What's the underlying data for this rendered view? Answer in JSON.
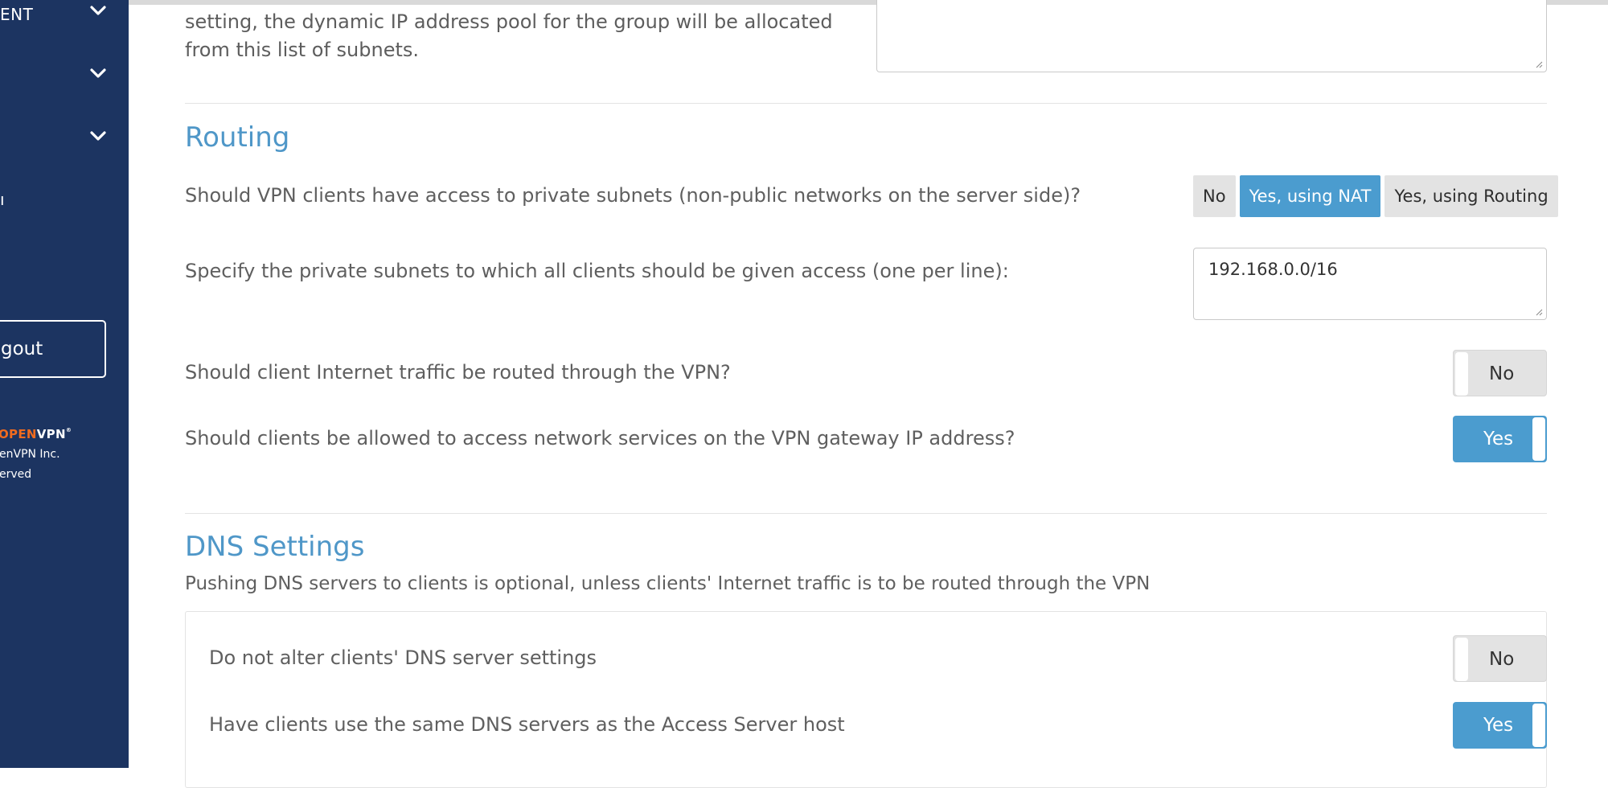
{
  "sidebar": {
    "items": [
      {
        "label": "ENT"
      },
      {
        "label": ""
      },
      {
        "label": ""
      },
      {
        "label": "ı"
      }
    ],
    "logout_label": "gout",
    "brand": {
      "open": "OPEN",
      "vpn": "VPN",
      "mark": "®"
    },
    "copyright_line1": "enVPN Inc.",
    "copyright_line2": "erved"
  },
  "intro": {
    "line1": "setting, the dynamic IP address pool for the group will be allocated",
    "line2": "from this list of subnets."
  },
  "routing": {
    "title": "Routing",
    "private_access_question": "Should VPN clients have access to private subnets (non-public networks on the server side)?",
    "options": [
      "No",
      "Yes, using NAT",
      "Yes, using Routing"
    ],
    "selected_option": "Yes, using NAT",
    "subnets_question": "Specify the private subnets to which all clients should be given access (one per line):",
    "subnets_value": "192.168.0.0/16",
    "internet_question": "Should client Internet traffic be routed through the VPN?",
    "internet_value": "No",
    "gateway_question": "Should clients be allowed to access network services on the VPN gateway IP address?",
    "gateway_value": "Yes"
  },
  "dns": {
    "title": "DNS Settings",
    "subtitle": "Pushing DNS servers to clients is optional, unless clients' Internet traffic is to be routed through the VPN",
    "no_alter_label": "Do not alter clients' DNS server settings",
    "no_alter_value": "No",
    "same_dns_label": "Have clients use the same DNS servers as the Access Server host",
    "same_dns_value": "Yes"
  },
  "colors": {
    "sidebar_bg": "#1c3461",
    "accent": "#4b9ccf",
    "brand_orange": "#f06b1f"
  },
  "icons": [
    "chevron-down-icon",
    "resize-grip-icon"
  ]
}
